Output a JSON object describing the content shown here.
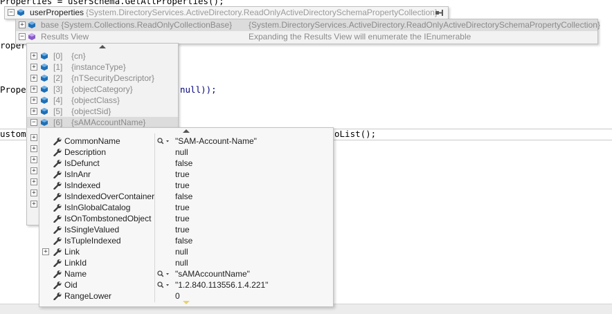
{
  "code": {
    "line1": "Properties = userSchema.GetAllProperties();",
    "line2_prefix": "roper",
    "line3_prefix": "Proper",
    "line3_suffix": "null));",
    "line4_prefix": "ustomP",
    "line4_suffix": "oList();"
  },
  "tip1": {
    "var_name": "userProperties",
    "var_type": "{System.DirectoryServices.ActiveDirectory.ReadOnlyActiveDirectorySchemaPropertyCollection}",
    "base_label": "base {System.Collections.ReadOnlyCollectionBase}",
    "base_value": "{System.DirectoryServices.ActiveDirectory.ReadOnlyActiveDirectorySchemaPropertyCollection}",
    "results_label": "Results View",
    "results_value": "Expanding the Results View will enumerate the IEnumerable"
  },
  "tip2": {
    "items": [
      {
        "index": "[0]",
        "value": "{cn}"
      },
      {
        "index": "[1]",
        "value": "{instanceType}"
      },
      {
        "index": "[2]",
        "value": "{nTSecurityDescriptor}"
      },
      {
        "index": "[3]",
        "value": "{objectCategory}"
      },
      {
        "index": "[4]",
        "value": "{objectClass}"
      },
      {
        "index": "[5]",
        "value": "{objectSid}"
      },
      {
        "index": "[6]",
        "value": "{sAMAccountName}"
      }
    ]
  },
  "props": {
    "rows": [
      {
        "name": "CommonName",
        "value": "\"SAM-Account-Name\"",
        "viewer": true
      },
      {
        "name": "Description",
        "value": "null",
        "viewer": false
      },
      {
        "name": "IsDefunct",
        "value": "false",
        "viewer": false
      },
      {
        "name": "IsInAnr",
        "value": "true",
        "viewer": false
      },
      {
        "name": "IsIndexed",
        "value": "true",
        "viewer": false
      },
      {
        "name": "IsIndexedOverContainer",
        "value": "false",
        "viewer": false
      },
      {
        "name": "IsInGlobalCatalog",
        "value": "true",
        "viewer": false
      },
      {
        "name": "IsOnTombstonedObject",
        "value": "true",
        "viewer": false
      },
      {
        "name": "IsSingleValued",
        "value": "true",
        "viewer": false
      },
      {
        "name": "IsTupleIndexed",
        "value": "false",
        "viewer": false
      },
      {
        "name": "Link",
        "value": "null",
        "viewer": false
      },
      {
        "name": "LinkId",
        "value": "null",
        "viewer": false
      },
      {
        "name": "Name",
        "value": "\"sAMAccountName\"",
        "viewer": true
      },
      {
        "name": "Oid",
        "value": "\"1.2.840.113556.1.4.221\"",
        "viewer": true
      },
      {
        "name": "RangeLower",
        "value": "0",
        "viewer": false
      }
    ]
  },
  "colors": {
    "selected_row": "#dcdcdc",
    "cube_blue": "#1f6fb5",
    "panel_bg": "#f5f5f5"
  }
}
